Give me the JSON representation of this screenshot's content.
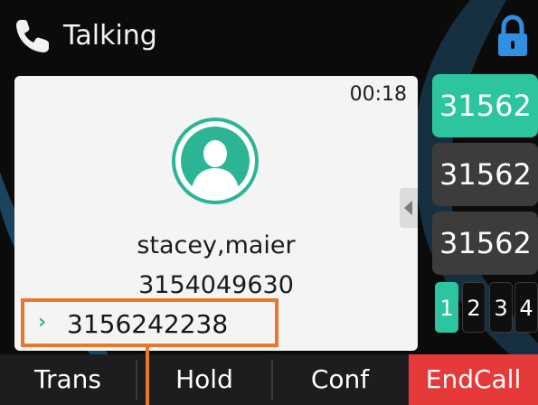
{
  "header": {
    "status_title": "Talking",
    "icons": [
      "phone-icon",
      "lock-icon"
    ]
  },
  "call": {
    "duration": "00:18",
    "contact_name": "stacey,maier",
    "contact_number": "3154049630",
    "dialed_number": "3156242238",
    "icons": [
      "avatar-icon",
      "chevron-right-icon"
    ]
  },
  "line_keys": [
    {
      "label": "31562",
      "active": true
    },
    {
      "label": "31562",
      "active": false
    },
    {
      "label": "31562",
      "active": false
    }
  ],
  "pages": [
    "1",
    "2",
    "3",
    "4"
  ],
  "softkeys": {
    "trans": "Trans",
    "hold": "Hold",
    "conf": "Conf",
    "endcall": "EndCall"
  },
  "colors": {
    "accent": "#2dc4a0",
    "endcall": "#e5393a",
    "annotation": "#e8782a",
    "background": "#0b0b0c"
  }
}
